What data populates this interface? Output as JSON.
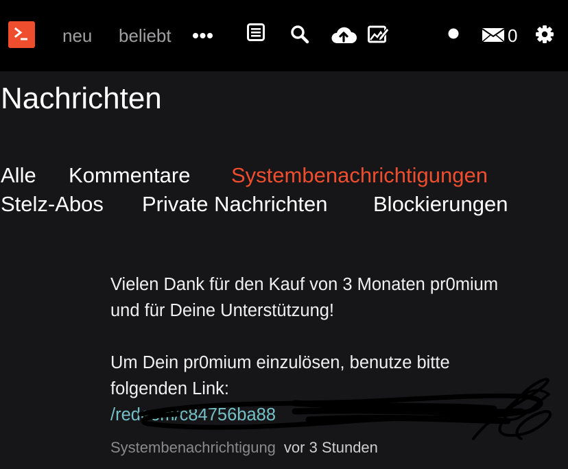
{
  "header": {
    "nav": [
      {
        "label": "neu"
      },
      {
        "label": "beliebt"
      }
    ],
    "message_count": "0",
    "colors": {
      "accent": "#ee4d2e",
      "bar": "#000000",
      "nav_text": "#a0a0a2"
    },
    "icons": [
      "terminal-logo-icon",
      "more-dots-icon",
      "list-icon",
      "search-icon",
      "upload-cloud-icon",
      "edit-image-icon",
      "status-dot-icon",
      "mail-icon",
      "gear-icon"
    ]
  },
  "page": {
    "title": "Nachrichten",
    "tabs": [
      {
        "label": "Alle",
        "active": false
      },
      {
        "label": "Kommentare",
        "active": false
      },
      {
        "label": "Systembenachrichtigungen",
        "active": true
      },
      {
        "label": "Stelz-Abos",
        "active": false
      },
      {
        "label": "Private Nachrichten",
        "active": false
      },
      {
        "label": "Blockierungen",
        "active": false
      }
    ]
  },
  "notification": {
    "paragraph1": [
      "Vielen Dank für den Kauf von 3 Monaten pr0mium",
      "und für Deine Unterstützung!"
    ],
    "paragraph2": [
      "Um Dein pr0mium einzulösen, benutze bitte",
      "folgenden Link:"
    ],
    "link": "/redeem/c84756ba88",
    "type": "Systembenachrichtigung",
    "time": "vor 3 Stunden",
    "link_color": "#75c0c7"
  }
}
